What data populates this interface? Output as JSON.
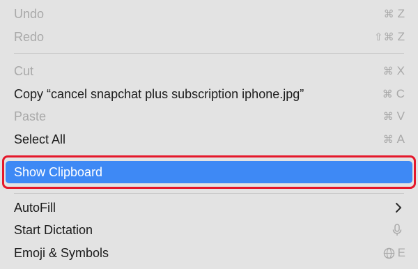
{
  "menu": {
    "undo": {
      "label": "Undo",
      "symbols": "⌘",
      "key": "Z"
    },
    "redo": {
      "label": "Redo",
      "symbols": "⇧⌘",
      "key": "Z"
    },
    "cut": {
      "label": "Cut",
      "symbols": "⌘",
      "key": "X"
    },
    "copy": {
      "label": "Copy “cancel snapchat plus subscription iphone.jpg”",
      "symbols": "⌘",
      "key": "C"
    },
    "paste": {
      "label": "Paste",
      "symbols": "⌘",
      "key": "V"
    },
    "select_all": {
      "label": "Select All",
      "symbols": "⌘",
      "key": "A"
    },
    "show_clipboard": {
      "label": "Show Clipboard"
    },
    "autofill": {
      "label": "AutoFill",
      "submenu_icon": "chevron-right-icon"
    },
    "start_dictation": {
      "label": "Start Dictation",
      "shortcut_icon": "microphone-icon"
    },
    "emoji_symbols": {
      "label": "Emoji & Symbols",
      "shortcut_icon": "globe-icon",
      "key": "E"
    }
  },
  "colors": {
    "menu_background": "#e3e3e3",
    "selection": "#3e89f5",
    "highlight_outline": "#e5182b",
    "disabled_text": "#a9a9a9"
  }
}
